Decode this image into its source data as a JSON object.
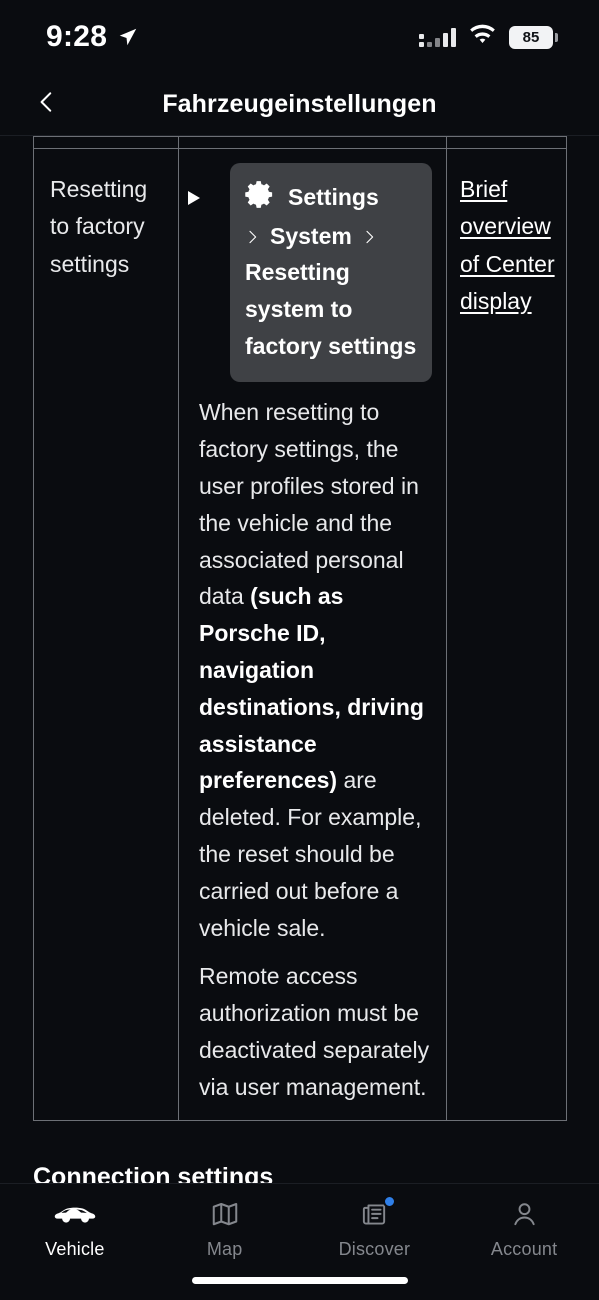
{
  "status_bar": {
    "time": "9:28",
    "location_icon": "location-arrow-icon",
    "signal_icon": "cellular-signal-icon",
    "wifi_icon": "wifi-icon",
    "battery_level": "85"
  },
  "header": {
    "back_icon": "chevron-left-icon",
    "title": "Fahrzeugeinstellungen"
  },
  "table": {
    "row": {
      "topic": "Resetting to factory settings",
      "marker_icon": "play-triangle-icon",
      "card": {
        "gear_icon": "gear-icon",
        "app_label": "Settings",
        "chevron_icon": "chevron-right-icon",
        "path_label": "System",
        "action_label": "Resetting system to factory settings"
      },
      "body": {
        "part1": "When resetting to factory settings, the user profiles stored in the vehicle and the associated personal data ",
        "bold": "(such as Porsche ID, navigation destinations, driving assistance preferences)",
        "part2": " are deleted. For example, the reset should be carried out before a vehicle sale.",
        "part3": "Remote access authorization must be deactivated separately via user management."
      },
      "link": "Brief overview of Center display"
    }
  },
  "section": {
    "connection_settings_title": "Connection settings"
  },
  "tabbar": {
    "items": [
      {
        "label": "Vehicle",
        "icon": "car-icon",
        "active": true,
        "badge": false
      },
      {
        "label": "Map",
        "icon": "map-icon",
        "active": false,
        "badge": false
      },
      {
        "label": "Discover",
        "icon": "newspaper-icon",
        "active": false,
        "badge": true
      },
      {
        "label": "Account",
        "icon": "person-icon",
        "active": false,
        "badge": false
      }
    ]
  },
  "colors": {
    "background": "#0a0c10",
    "card": "#3f4145",
    "border": "#6d7076",
    "badge": "#2f7fe8",
    "text": "#ffffff",
    "muted": "#84878d"
  }
}
